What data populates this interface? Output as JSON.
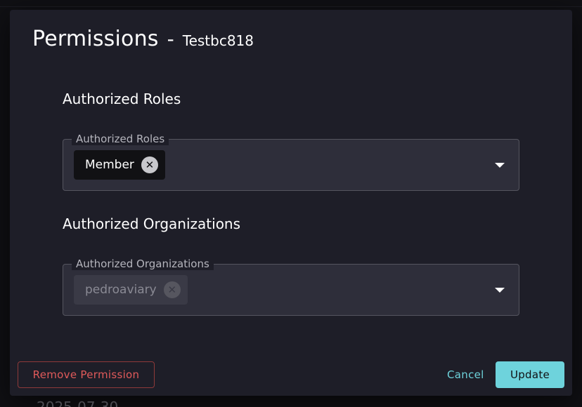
{
  "dialog": {
    "title": "Permissions",
    "separator": "-",
    "subtitle": "Testbc818"
  },
  "roles": {
    "heading": "Authorized Roles",
    "field_label": "Authorized Roles",
    "chips": [
      {
        "label": "Member",
        "remove_icon": "✕"
      }
    ],
    "dropdown_icon": "caret-down-icon"
  },
  "organizations": {
    "heading": "Authorized Organizations",
    "field_label": "Authorized Organizations",
    "chips": [
      {
        "label": "pedroaviary",
        "remove_icon": "✕"
      }
    ],
    "dropdown_icon": "caret-down-icon"
  },
  "actions": {
    "remove_label": "Remove Permission",
    "cancel_label": "Cancel",
    "update_label": "Update"
  },
  "background": {
    "date_fragment": "2025-07-30"
  },
  "colors": {
    "accent": "#6ed3dc",
    "danger": "#e05a5a",
    "dialog_bg": "#1e1e28",
    "field_bg": "#2e2e3a"
  }
}
